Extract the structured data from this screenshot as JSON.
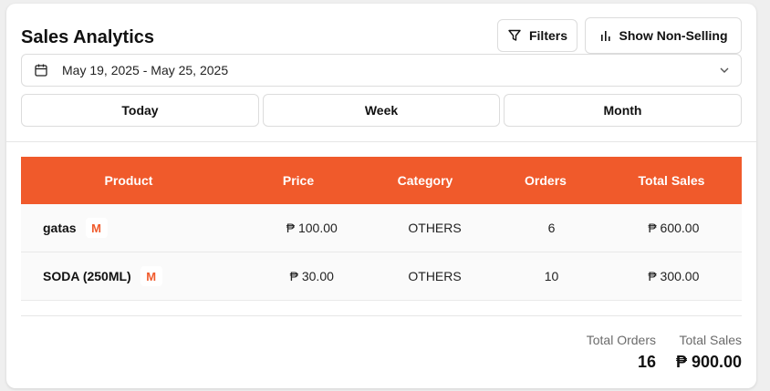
{
  "header": {
    "title": "Sales Analytics",
    "filters_label": "Filters",
    "non_selling_label": "Show Non-Selling"
  },
  "date_range": {
    "value": "May 19, 2025 - May 25, 2025",
    "icon": "calendar-icon"
  },
  "range_buttons": [
    "Today",
    "Week",
    "Month"
  ],
  "table": {
    "columns": [
      "Product",
      "Price",
      "Category",
      "Orders",
      "Total Sales"
    ],
    "rows": [
      {
        "product": "gatas",
        "badge": "M",
        "price": "₱ 100.00",
        "category": "OTHERS",
        "orders": "6",
        "total": "₱ 600.00"
      },
      {
        "product": "SODA (250ML)",
        "badge": "M",
        "price": "₱ 30.00",
        "category": "OTHERS",
        "orders": "10",
        "total": "₱ 300.00"
      }
    ]
  },
  "totals": {
    "orders_label": "Total Orders",
    "orders_value": "16",
    "sales_label": "Total Sales",
    "sales_value": "₱ 900.00"
  },
  "colors": {
    "accent": "#f05a2b"
  }
}
